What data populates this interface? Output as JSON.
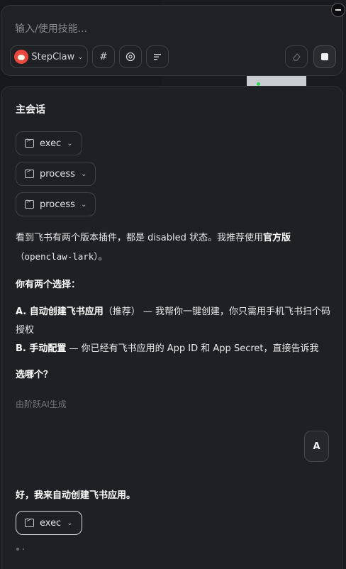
{
  "input": {
    "placeholder": "输入/使用技能...",
    "model_label": "StepClaw",
    "hash_icon": "#"
  },
  "chat": {
    "title": "主会话",
    "tools": [
      "exec",
      "process",
      "process"
    ],
    "paragraph1": {
      "text_a": "看到飞书有两个版本插件，都是 disabled 状态。我推荐使用",
      "bold": "官方版",
      "code": "（openclaw-lark）",
      "tail": "。"
    },
    "choices_heading": "你有两个选择：",
    "option_a": {
      "label": "A. 自动创建飞书应用",
      "note": "（推荐）",
      "desc": " — 我帮你一键创建，你只需用手机飞书扫个码授权"
    },
    "option_b": {
      "label": "B. 手动配置",
      "desc": " — 你已经有飞书应用的 App ID 和 App Secret，直接告诉我"
    },
    "question": "选哪个？",
    "generated_by": "由阶跃AI生成",
    "user_message": "A",
    "reply": "好，我来自动创建飞书应用。",
    "reply_tool": "exec"
  },
  "colors": {
    "background": "#17181b",
    "panel": "#1f2023",
    "accent_red": "#e7473c",
    "led_green": "#2fd35a"
  },
  "icons": [
    "close-icon",
    "stepclaw-avatar-icon",
    "chevron-down-icon",
    "hash-icon",
    "settings-icon",
    "list-icon",
    "eraser-icon",
    "stop-icon",
    "terminal-icon"
  ]
}
